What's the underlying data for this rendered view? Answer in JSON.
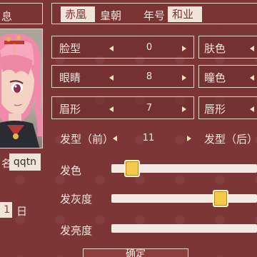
{
  "colors": {
    "panel_bg": "#7d3636",
    "border": "#e8d7c6",
    "input_bg": "#efe4d9",
    "accent_text": "#8a2e2e",
    "slider_thumb": "#f6c94a"
  },
  "left_panel": {
    "tab_label": "息",
    "name_prefix": "名",
    "name_value": "qqtn",
    "date_value": "1",
    "date_unit": "日"
  },
  "topbar": {
    "dynasty_value": "赤凰",
    "dynasty_label": "皇朝",
    "era_label": "年号",
    "era_value": "和业"
  },
  "rows": {
    "face": {
      "label": "脸型",
      "value": "0"
    },
    "skin": {
      "label": "肤色"
    },
    "eyes": {
      "label": "眼睛",
      "value": "8"
    },
    "pupil": {
      "label": "瞳色"
    },
    "brow": {
      "label": "眉形",
      "value": "7"
    },
    "lip": {
      "label": "唇形"
    },
    "hair_front": {
      "label": "发型（前）",
      "value": "11"
    },
    "hair_back": {
      "label": "发型（后）"
    }
  },
  "color_sliders": {
    "hair_color": {
      "label": "发色",
      "value_pct": 14
    },
    "hair_gray": {
      "label": "发灰度",
      "value_pct": 75
    },
    "hair_bright": {
      "label": "发亮度"
    }
  },
  "confirm_label": "确定"
}
